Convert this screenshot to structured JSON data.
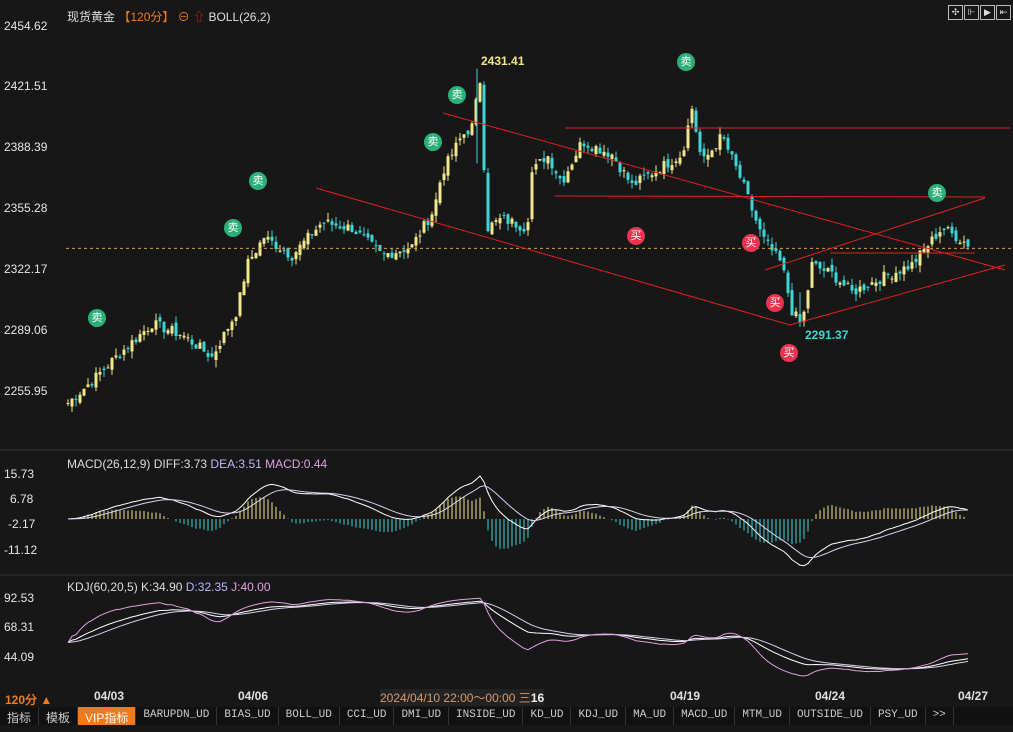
{
  "header": {
    "title": "现货黄金",
    "period": "【120分】",
    "indicator": "BOLL(26,2)"
  },
  "toolbar": [
    "crosshair-icon",
    "zoom-icon",
    "play-icon",
    "exit-icon"
  ],
  "price_axis": [
    "2454.62",
    "2421.51",
    "2388.39",
    "2355.28",
    "2322.17",
    "2289.06",
    "2255.95"
  ],
  "annotations": {
    "high": "2431.41",
    "low": "2291.37",
    "sell": "卖",
    "buy": "买"
  },
  "macd": {
    "title": "MACD(26,12,9)",
    "diff": "DIFF:3.73",
    "dea": "DEA:3.51",
    "macd": "MACD:0.44",
    "axis": [
      "15.73",
      "6.78",
      "-2.17",
      "-11.12"
    ]
  },
  "kdj": {
    "title": "KDJ(60,20,5)",
    "k": "K:34.90",
    "d": "D:32.35",
    "j": "J:40.00",
    "axis": [
      "92.53",
      "68.31",
      "44.09"
    ]
  },
  "time_axis": {
    "period": "120分 ▲",
    "dates": [
      "04/03",
      "04/06",
      "04/19",
      "04/24",
      "04/27"
    ],
    "cursor": "2024/04/10 22:00～00:00 三",
    "cursor_tail": "16"
  },
  "tabs": [
    "指标",
    "模板",
    "VIP指标",
    "BARUPDN_UD",
    "BIAS_UD",
    "BOLL_UD",
    "CCI_UD",
    "DMI_UD",
    "INSIDE_UD",
    "KD_UD",
    "KDJ_UD",
    "MA_UD",
    "MACD_UD",
    "MTM_UD",
    "OUTSIDE_UD",
    "PSY_UD",
    ">>"
  ],
  "colors": {
    "up": "#f0e68c",
    "down": "#3cd6d6",
    "line": "#e02020",
    "accent": "#f07a1a"
  },
  "chart_data": {
    "type": "candlestick",
    "title": "现货黄金 120分",
    "ylim": [
      2240,
      2460
    ],
    "price_path": [
      [
        0,
        2250
      ],
      [
        24,
        2262
      ],
      [
        54,
        2278
      ],
      [
        84,
        2293
      ],
      [
        114,
        2287
      ],
      [
        144,
        2275
      ],
      [
        169,
        2300
      ],
      [
        179,
        2325
      ],
      [
        196,
        2340
      ],
      [
        224,
        2330
      ],
      [
        254,
        2348
      ],
      [
        284,
        2345
      ],
      [
        314,
        2330
      ],
      [
        344,
        2335
      ],
      [
        366,
        2355
      ],
      [
        374,
        2375
      ],
      [
        394,
        2395
      ],
      [
        404,
        2400
      ],
      [
        412,
        2425
      ],
      [
        419,
        2345
      ],
      [
        434,
        2350
      ],
      [
        459,
        2345
      ],
      [
        464,
        2375
      ],
      [
        479,
        2385
      ],
      [
        494,
        2370
      ],
      [
        514,
        2392
      ],
      [
        544,
        2385
      ],
      [
        564,
        2368
      ],
      [
        584,
        2375
      ],
      [
        614,
        2385
      ],
      [
        624,
        2410
      ],
      [
        634,
        2380
      ],
      [
        654,
        2395
      ],
      [
        674,
        2370
      ],
      [
        694,
        2340
      ],
      [
        714,
        2325
      ],
      [
        724,
        2300
      ],
      [
        734,
        2292
      ],
      [
        744,
        2325
      ],
      [
        764,
        2320
      ],
      [
        784,
        2310
      ],
      [
        814,
        2318
      ],
      [
        844,
        2325
      ],
      [
        874,
        2345
      ],
      [
        904,
        2335
      ]
    ],
    "high": 2431.41,
    "low": 2291.37,
    "last": 2335
  }
}
